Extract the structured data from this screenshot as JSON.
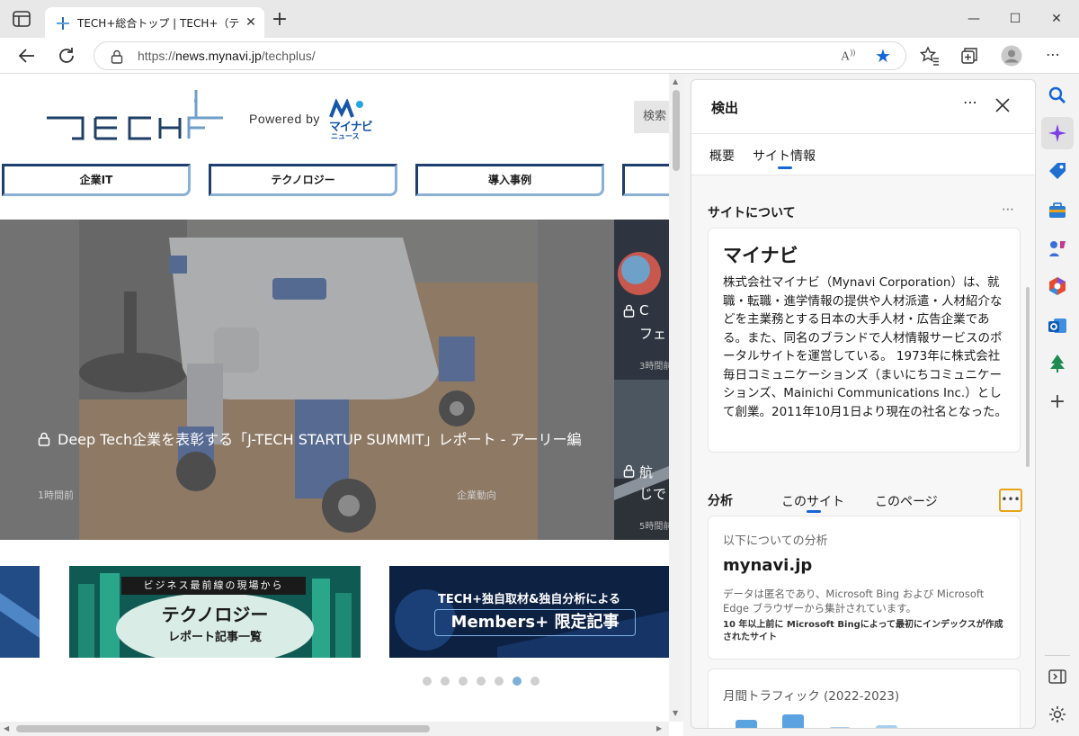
{
  "browser": {
    "tab_title": "TECH+総合トップ | TECH+（テック",
    "url_prefix": "https://",
    "url_domain": "news.mynavi.jp",
    "url_path": "/techplus/",
    "read_aloud_label": "A",
    "accent": "#1466d8"
  },
  "page": {
    "powered_by": "Powered by",
    "mynavi_logo_text": "マイナビ",
    "mynavi_logo_sub": "ニュース",
    "search_label": "検索",
    "nav_tabs": [
      "企業IT",
      "テクノロジー",
      "導入事例"
    ],
    "hero": {
      "title": "Deep Tech企業を表彰する「J-TECH STARTUP SUMMIT」レポート - アーリー編",
      "time": "1時間前",
      "category": "企業動向"
    },
    "side_cards": [
      {
        "title": "C",
        "title2": "フェ",
        "time": "3時間前"
      },
      {
        "title": "航",
        "title2": "じで",
        "time": "5時間前"
      }
    ],
    "banners": [
      {
        "tag": "ビジネス最前線の現場から",
        "title": "テクノロジー",
        "subtitle": "レポート記事一覧"
      },
      {
        "title": "TECH+独自取材&独自分析による",
        "subtitle": "Members+ 限定記事"
      }
    ],
    "carousel_count": 7,
    "carousel_active": 6
  },
  "panel": {
    "title": "検出",
    "tabs": [
      "概要",
      "サイト情報"
    ],
    "active_tab": "サイト情報",
    "about_heading": "サイトについて",
    "about_name": "マイナビ",
    "about_text": "株式会社マイナビ（Mynavi Corporation）は、就職・転職・進学情報の提供や人材派遣・人材紹介などを主業務とする日本の大手人材・広告企業である。また、同名のブランドで人材情報サービスのポータルサイトを運営している。 1973年に株式会社毎日コミュニケーションズ（まいにちコミュニケーションズ、Mainichi Communications Inc.）として創業。2011年10月1日より現在の社名となった。",
    "analysis_heading": "分析",
    "analysis_tabs": [
      "このサイト",
      "このページ"
    ],
    "analysis_label": "以下についての分析",
    "analysis_domain": "mynavi.jp",
    "analysis_note": "データは匿名であり、Microsoft Bing および Microsoft Edge ブラウザーから集計されています。",
    "analysis_first": "10 年以上前に Microsoft Bingによって最初にインデックスが作成されたサイト",
    "traffic_title": "月間トラフィック (2022-2023)"
  }
}
